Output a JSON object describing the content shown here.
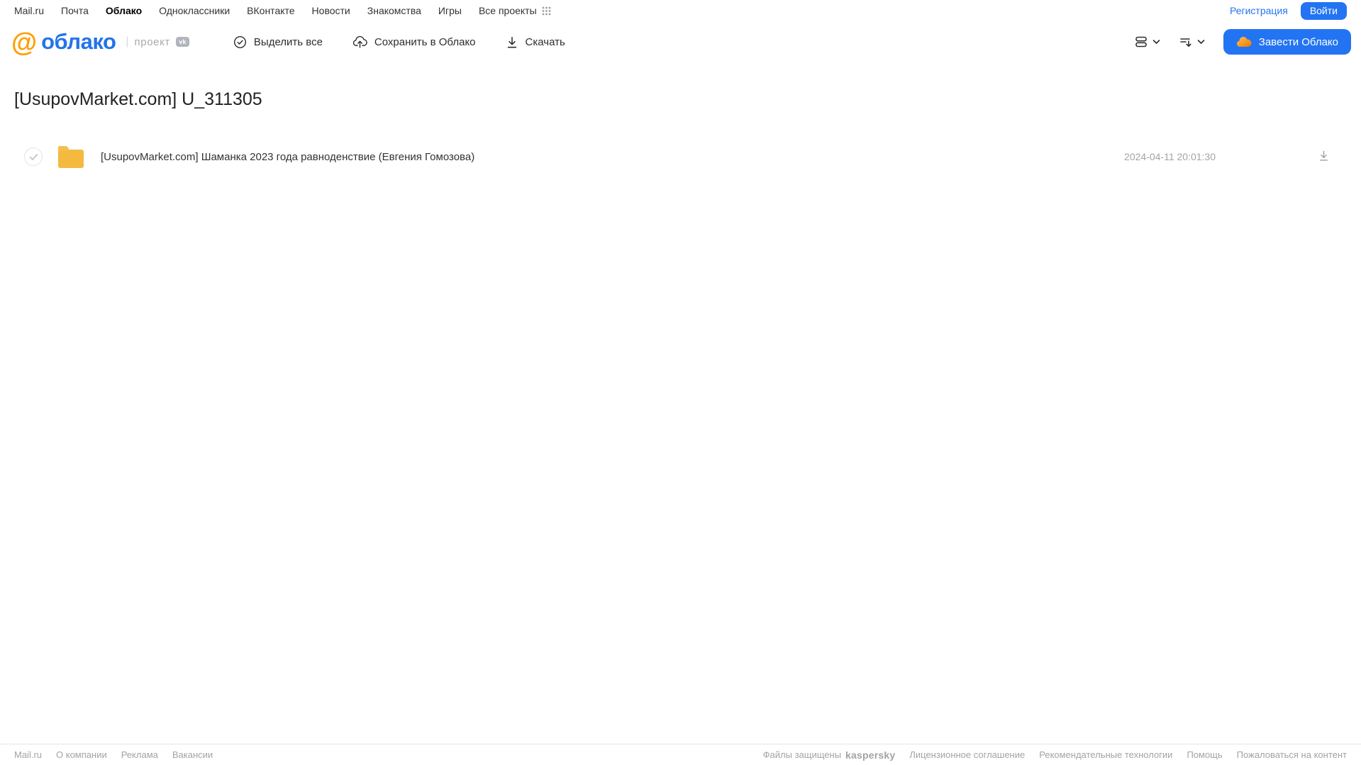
{
  "topbar": {
    "links": [
      {
        "label": "Mail.ru"
      },
      {
        "label": "Почта"
      },
      {
        "label": "Облако"
      },
      {
        "label": "Одноклассники"
      },
      {
        "label": "ВКонтакте"
      },
      {
        "label": "Новости"
      },
      {
        "label": "Знакомства"
      },
      {
        "label": "Игры"
      }
    ],
    "active_link": "Облако",
    "projects_label": "Все проекты",
    "registration_label": "Регистрация",
    "login_label": "Войти"
  },
  "header": {
    "logo_at": "@",
    "logo_text": "облако",
    "divider": "|",
    "project_label": "проект",
    "vk_badge": "vk",
    "toolbar": {
      "select_all_label": "Выделить все",
      "save_to_cloud_label": "Сохранить в Облако",
      "download_label": "Скачать"
    },
    "create_cloud_label": "Завести Облако"
  },
  "main": {
    "title": "[UsupovMarket.com] U_311305",
    "files": [
      {
        "type": "folder",
        "name": "[UsupovMarket.com] Шаманка 2023 года равноденствие (Евгения Гомозова)",
        "date": "2024-04-11 20:01:30"
      }
    ]
  },
  "footer": {
    "left_links": [
      "Mail.ru",
      "О компании",
      "Реклама",
      "Вакансии"
    ],
    "protected_label": "Файлы защищены",
    "kaspersky_label": "kaspersky",
    "right_links": [
      "Лицензионное соглашение",
      "Рекомендательные технологии",
      "Помощь",
      "Пожаловаться на контент"
    ]
  },
  "colors": {
    "accent_blue": "#2374f2",
    "logo_blue": "#2374e8",
    "logo_orange": "#ff9e00",
    "folder_yellow": "#f3ba3f",
    "kaspersky_green": "#2e9284"
  }
}
